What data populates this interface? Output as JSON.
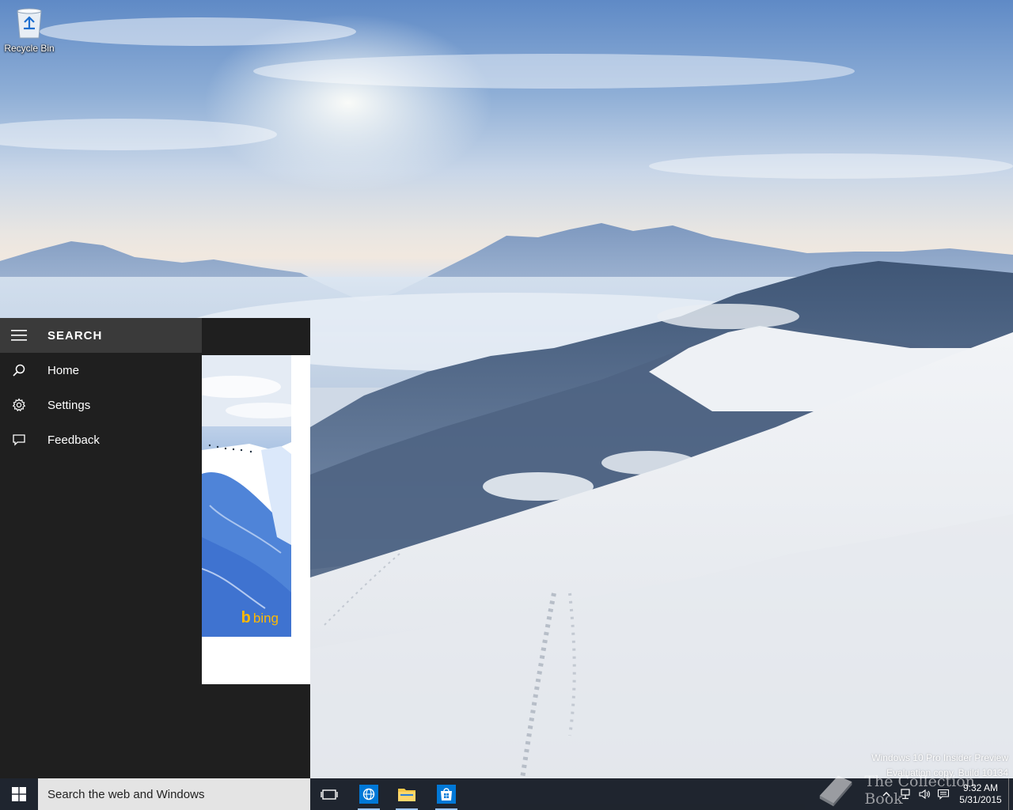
{
  "desktop": {
    "recycle_bin_label": "Recycle Bin",
    "watermark_line1": "Windows 10 Pro Insider Preview",
    "watermark_line2": "Evaluation copy. Build 10134",
    "collection_watermark": "The Collection Book"
  },
  "search_panel": {
    "title": "SEARCH",
    "nav_items": [
      {
        "label": "Home",
        "icon": "search-icon"
      },
      {
        "label": "Settings",
        "icon": "gear-icon"
      },
      {
        "label": "Feedback",
        "icon": "feedback-icon"
      }
    ],
    "bing_label": "bing"
  },
  "taskbar": {
    "search_placeholder": "Search the web and Windows",
    "pinned_apps": [
      "task-view-icon",
      "internet-explorer-icon",
      "file-explorer-icon",
      "store-icon"
    ],
    "clock_time": "9:32 AM",
    "clock_date": "5/31/2015"
  },
  "colors": {
    "panel_bg": "#1f1f1f",
    "panel_header_bg": "#3a3a3a",
    "accent_blue": "#0078d7",
    "bing_yellow": "#ffb900",
    "search_box_bg": "#e4e4e4"
  }
}
